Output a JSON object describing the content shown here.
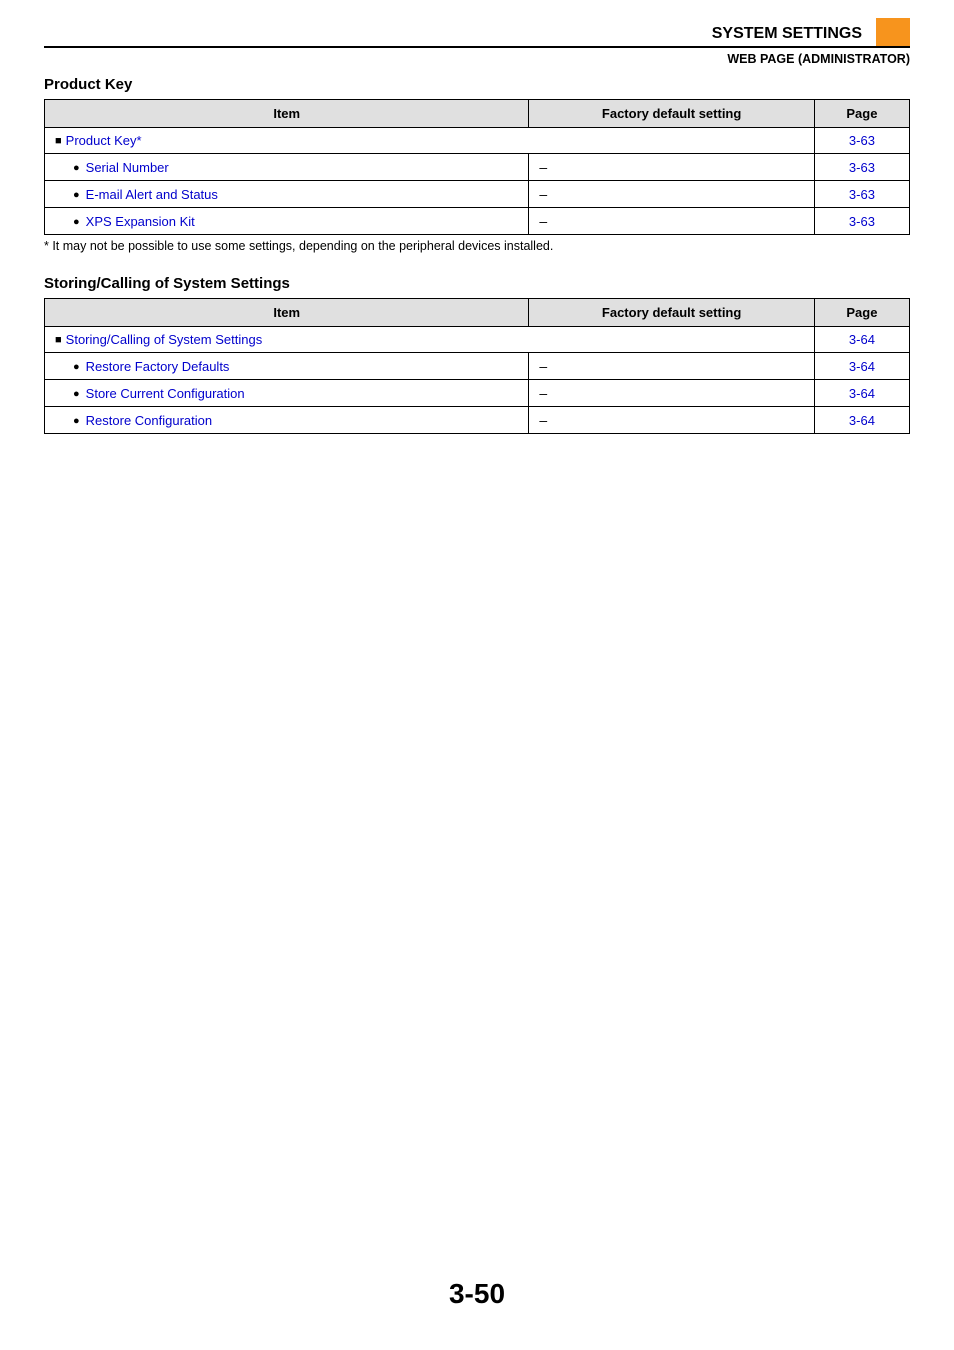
{
  "header": {
    "system_settings": "SYSTEM SETTINGS",
    "breadcrumb": "WEB PAGE (ADMINISTRATOR)"
  },
  "columns": {
    "item": "Item",
    "default": "Factory default setting",
    "page": "Page"
  },
  "section1": {
    "title": "Product Key",
    "heading_row": {
      "label": "Product Key*",
      "page": "3-63"
    },
    "rows": [
      {
        "label": "Serial Number",
        "default": "–",
        "page": "3-63"
      },
      {
        "label": "E-mail Alert and Status",
        "default": "–",
        "page": "3-63"
      },
      {
        "label": "XPS Expansion Kit",
        "default": "–",
        "page": "3-63"
      }
    ],
    "note": "*  It may not be possible to use some settings, depending on the peripheral devices installed."
  },
  "section2": {
    "title": "Storing/Calling of System Settings",
    "heading_row": {
      "label": "Storing/Calling of System Settings",
      "page": "3-64"
    },
    "rows": [
      {
        "label": "Restore Factory Defaults",
        "default": "–",
        "page": "3-64"
      },
      {
        "label": "Store Current Configuration",
        "default": "–",
        "page": "3-64"
      },
      {
        "label": "Restore Configuration",
        "default": "–",
        "page": "3-64"
      }
    ]
  },
  "page_number": "3-50"
}
